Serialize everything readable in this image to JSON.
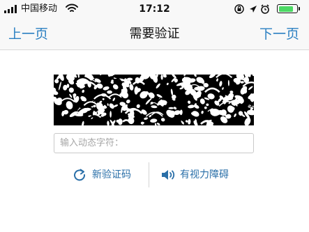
{
  "status_bar": {
    "carrier": "中国移动",
    "time": "17:12",
    "battery_level_percent": 80,
    "icons": [
      "signal-icon",
      "wifi-icon",
      "screen-lock-icon",
      "location-icon",
      "alarm-icon",
      "battery-icon"
    ]
  },
  "nav": {
    "prev_label": "上一页",
    "title": "需要验证",
    "next_label": "下一页"
  },
  "captcha": {
    "icon": "captcha-image"
  },
  "input": {
    "placeholder": "输入动态字符：",
    "value": ""
  },
  "actions": {
    "refresh_label": "新验证码",
    "audio_label": "有视力障碍"
  },
  "colors": {
    "accent": "#2a7fc2",
    "link": "#2a6fa8",
    "bar_background": "#f8f8f8",
    "battery": "#4cd964"
  }
}
